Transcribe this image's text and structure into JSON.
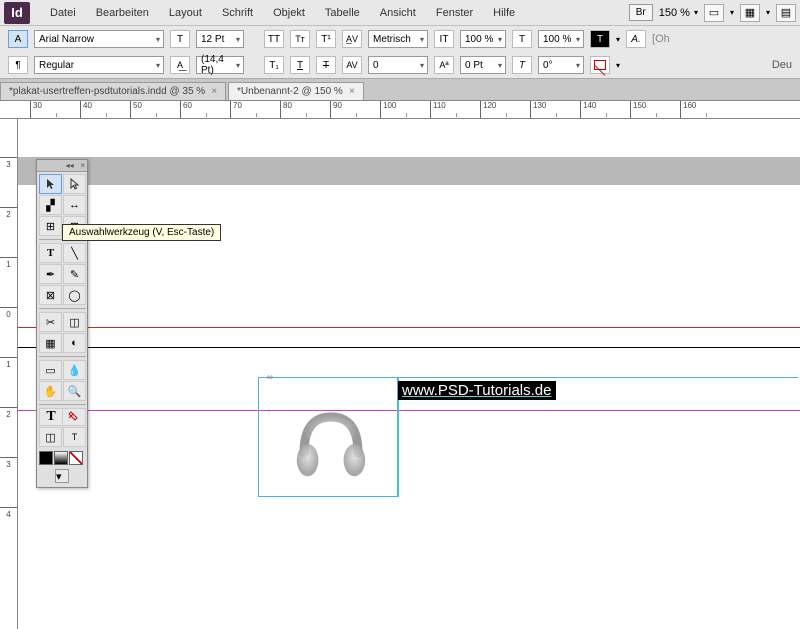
{
  "app": {
    "name": "Id"
  },
  "menu": {
    "items": [
      "Datei",
      "Bearbeiten",
      "Layout",
      "Schrift",
      "Objekt",
      "Tabelle",
      "Ansicht",
      "Fenster",
      "Hilfe"
    ],
    "br_label": "Br",
    "zoom": "150 %"
  },
  "controls": {
    "font": "Arial Narrow",
    "style": "Regular",
    "size": "12 Pt",
    "leading": "(14,4 Pt)",
    "kerning": "Metrisch",
    "tracking": "0",
    "vscale": "100 %",
    "hscale": "100 %",
    "baseline": "0 Pt",
    "skew": "0°",
    "lang": "Deu",
    "hint": "[Oh"
  },
  "tabs": [
    {
      "label": "*plakat-usertreffen-psdtutorials.indd @ 35 %",
      "active": false
    },
    {
      "label": "*Unbenannt-2 @ 150 %",
      "active": true
    }
  ],
  "ruler_h": [
    "30",
    "40",
    "50",
    "60",
    "70",
    "80",
    "90",
    "100",
    "110",
    "120",
    "130",
    "140",
    "150",
    "160"
  ],
  "ruler_v": [
    "3",
    "2",
    "1",
    "0",
    "1",
    "2",
    "3",
    "4"
  ],
  "tooltip": "Auswahlwerkzeug (V, Esc-Taste)",
  "canvas": {
    "url_text": "www.PSD-Tutorials.de"
  }
}
